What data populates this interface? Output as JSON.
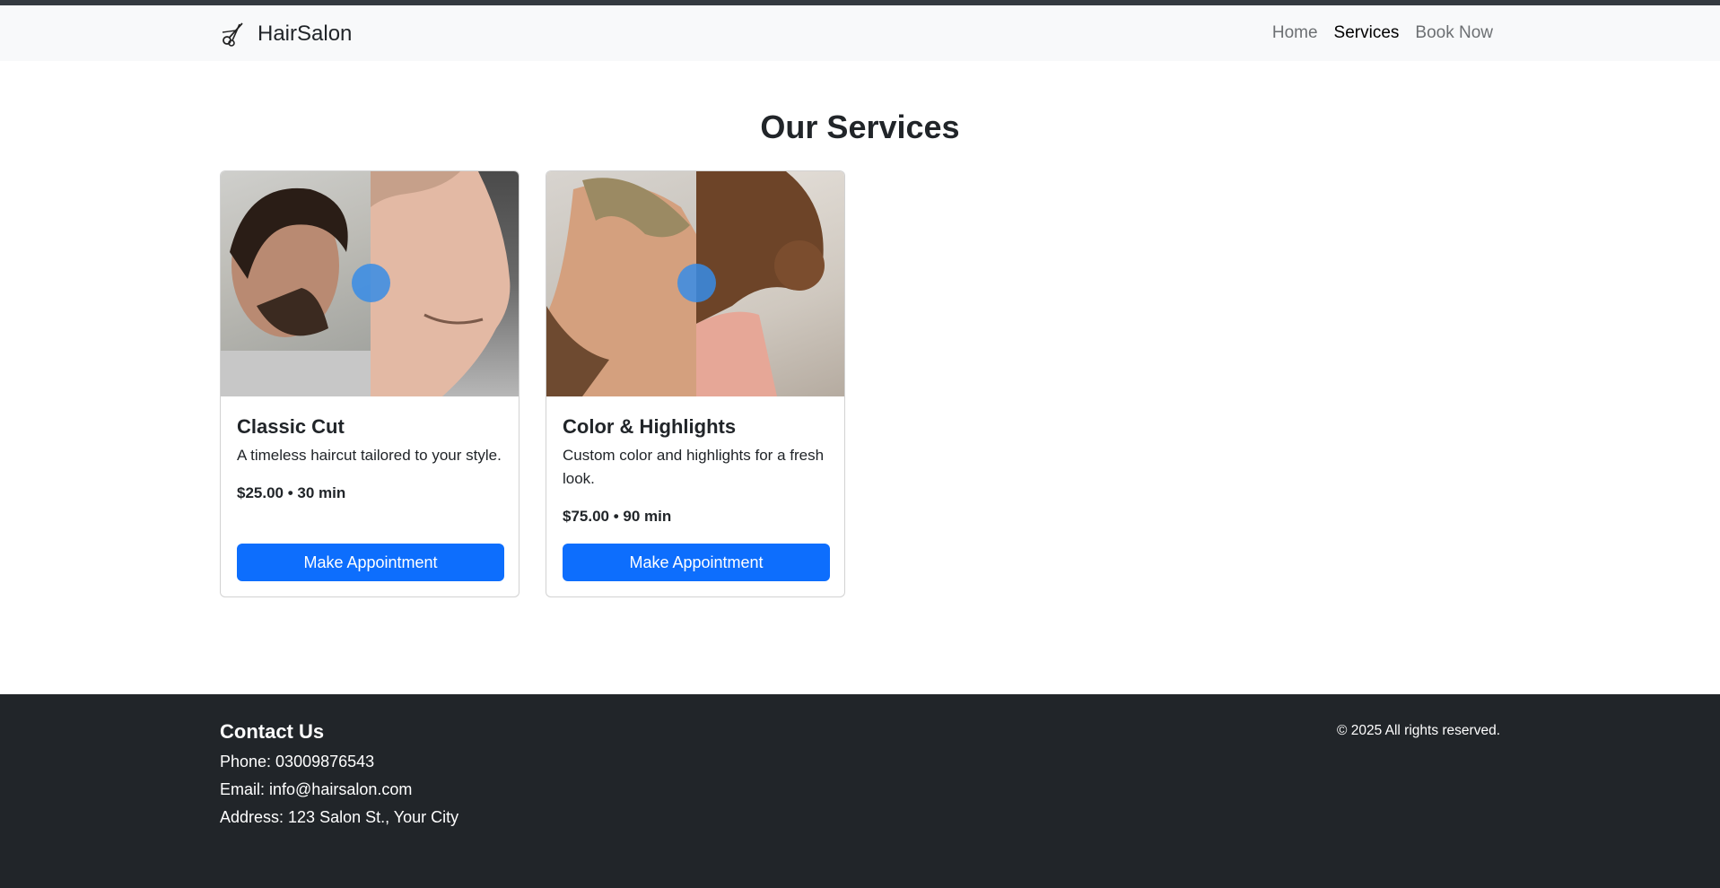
{
  "navbar": {
    "brand": "HairSalon",
    "brand_icon": "scissors-icon",
    "links": [
      {
        "label": "Home",
        "active": false
      },
      {
        "label": "Services",
        "active": true
      },
      {
        "label": "Book Now",
        "active": false
      }
    ]
  },
  "main": {
    "title": "Our Services",
    "services": [
      {
        "title": "Classic Cut",
        "description": "A timeless haircut tailored to your style.",
        "price_line": "$25.00 • 30 min",
        "button_label": "Make Appointment",
        "image": "before-after-haircut-photo"
      },
      {
        "title": "Color & Highlights",
        "description": "Custom color and highlights for a fresh look.",
        "price_line": "$75.00 • 90 min",
        "button_label": "Make Appointment",
        "image": "before-after-hair-color-photo"
      }
    ]
  },
  "footer": {
    "heading": "Contact Us",
    "phone": "Phone: 03009876543",
    "email": "Email: info@hairsalon.com",
    "address": "Address: 123 Salon St., Your City",
    "copyright": "© 2025 All rights reserved."
  },
  "colors": {
    "primary": "#0d6efd",
    "navbar_bg": "#f8f9fa",
    "footer_bg": "#212529",
    "top_strip": "#343a40"
  }
}
